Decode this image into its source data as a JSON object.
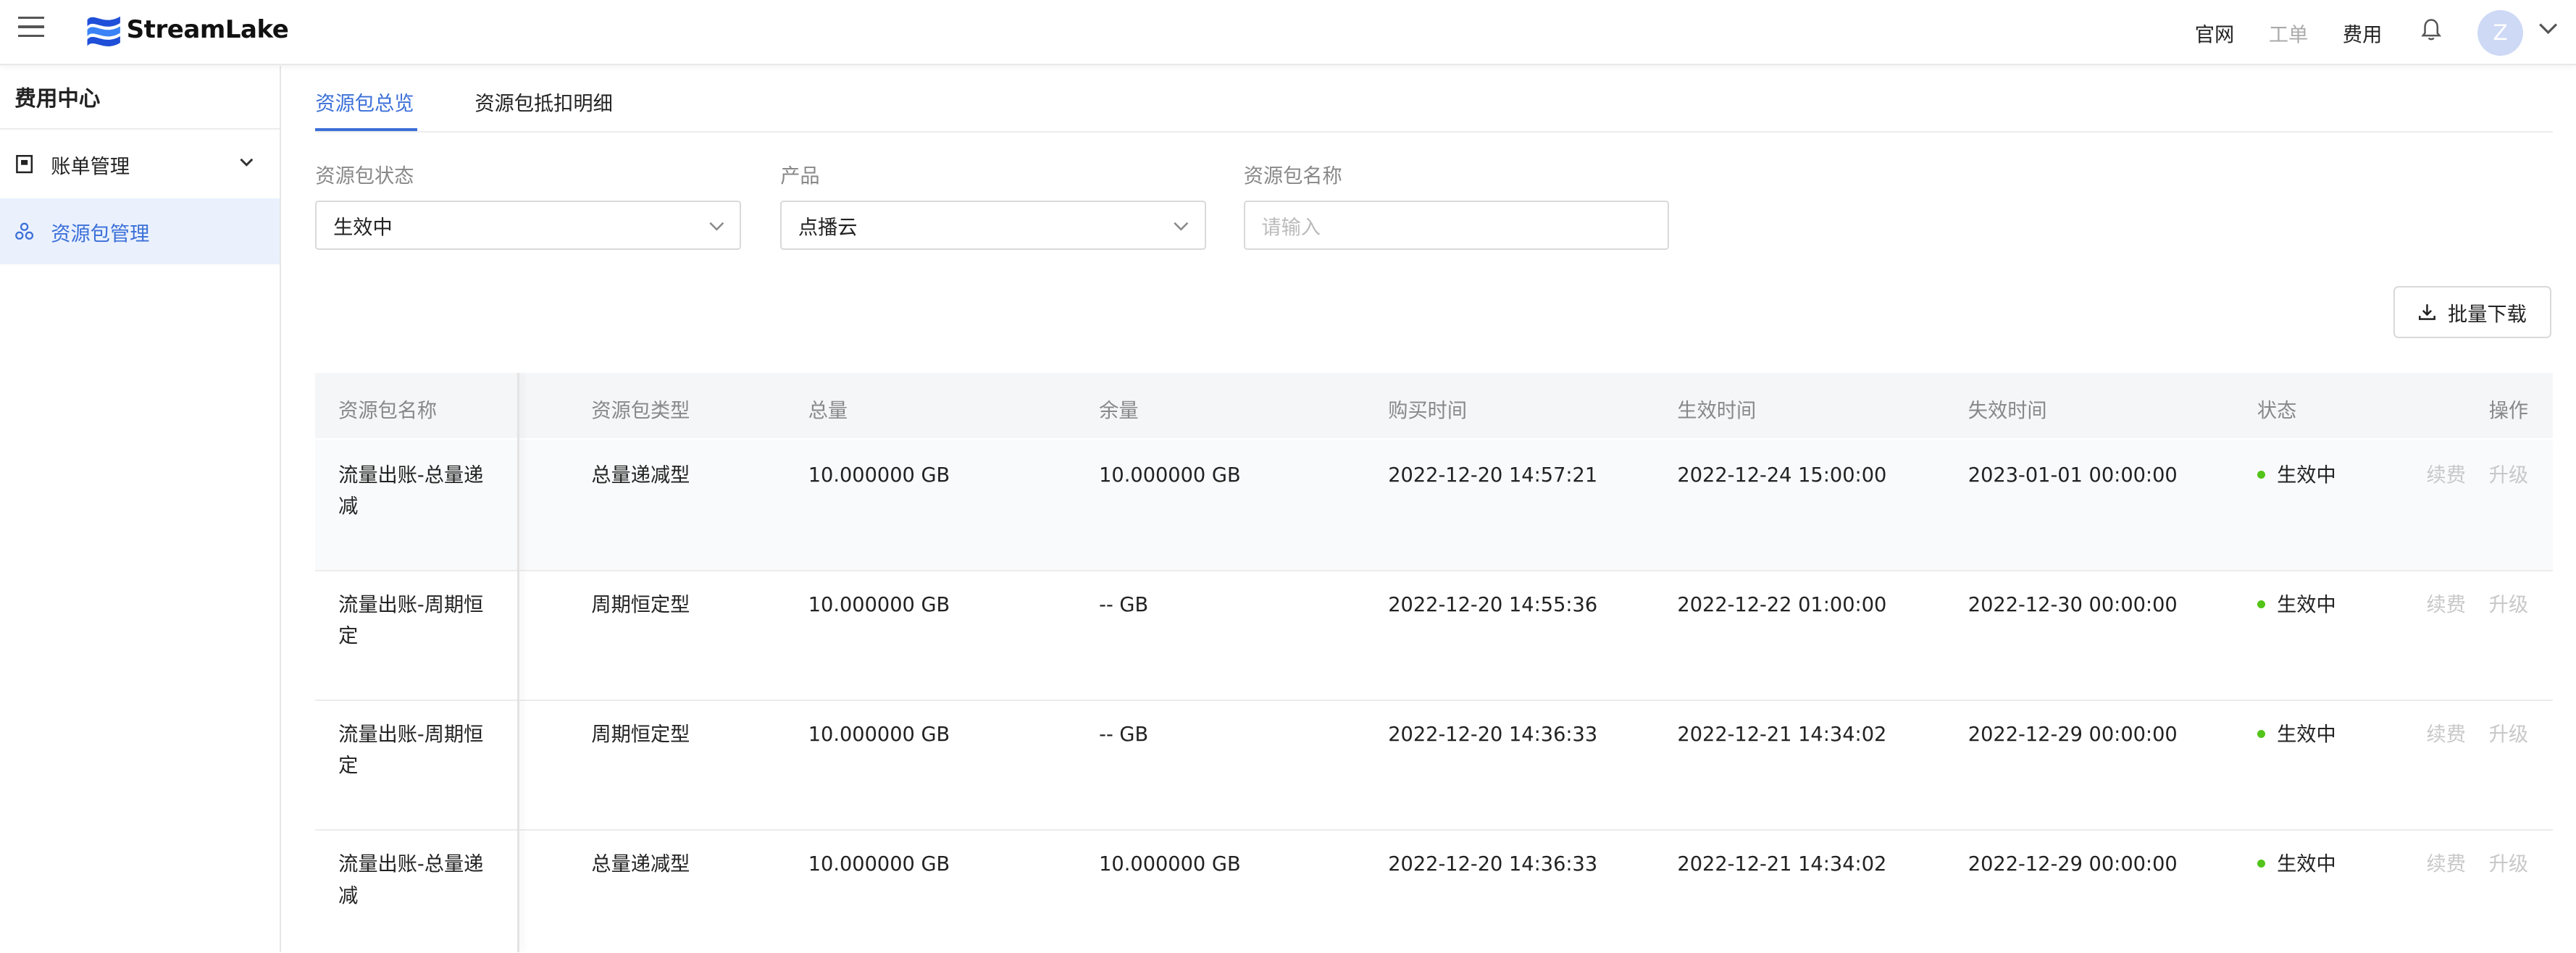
{
  "header": {
    "brand": "StreamLake",
    "nav": [
      "官网",
      "工单",
      "费用"
    ],
    "avatar_letter": "Z",
    "brand_colors": [
      "#1f4fd8",
      "#3b82f6"
    ]
  },
  "sidebar": {
    "title": "费用中心",
    "items": [
      {
        "label": "账单管理",
        "icon": "bill-icon"
      },
      {
        "label": "资源包管理",
        "icon": "package-icon"
      }
    ]
  },
  "tabs": [
    "资源包总览",
    "资源包抵扣明细"
  ],
  "filters": {
    "status": {
      "label": "资源包状态",
      "value": "生效中"
    },
    "product": {
      "label": "产品",
      "value": "点播云"
    },
    "name": {
      "label": "资源包名称",
      "placeholder": "请输入"
    }
  },
  "batch_download": "批量下载",
  "table": {
    "headers": [
      "资源包名称",
      "资源包类型",
      "总量",
      "余量",
      "购买时间",
      "生效时间",
      "失效时间",
      "状态",
      "操作"
    ],
    "actions": [
      "续费",
      "升级"
    ],
    "rows": [
      {
        "name": "流量出账-总量递减",
        "type": "总量递减型",
        "total": "10.000000 GB",
        "remaining": "10.000000 GB",
        "purchased": "2022-12-20 14:57:21",
        "effective": "2022-12-24 15:00:00",
        "expires": "2023-01-01 00:00:00",
        "status": "生效中"
      },
      {
        "name": "流量出账-周期恒定",
        "type": "周期恒定型",
        "total": "10.000000 GB",
        "remaining": "-- GB",
        "purchased": "2022-12-20 14:55:36",
        "effective": "2022-12-22 01:00:00",
        "expires": "2022-12-30 00:00:00",
        "status": "生效中"
      },
      {
        "name": "流量出账-周期恒定",
        "type": "周期恒定型",
        "total": "10.000000 GB",
        "remaining": "-- GB",
        "purchased": "2022-12-20 14:36:33",
        "effective": "2022-12-21 14:34:02",
        "expires": "2022-12-29 00:00:00",
        "status": "生效中"
      },
      {
        "name": "流量出账-总量递减",
        "type": "总量递减型",
        "total": "10.000000 GB",
        "remaining": "10.000000 GB",
        "purchased": "2022-12-20 14:36:33",
        "effective": "2022-12-21 14:34:02",
        "expires": "2022-12-29 00:00:00",
        "status": "生效中"
      }
    ]
  }
}
